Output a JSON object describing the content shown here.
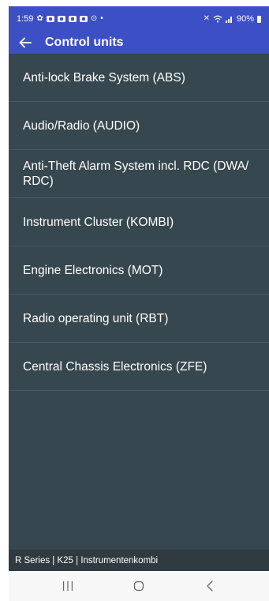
{
  "status_bar": {
    "time": "1:59",
    "battery": "90%",
    "icons": [
      "gear-icon",
      "notification-icon",
      "notification-icon",
      "notification-icon",
      "notification-icon",
      "sync-icon",
      "dot-icon"
    ],
    "right_icons": [
      "mute-icon",
      "wifi-icon",
      "signal-icon",
      "battery-icon"
    ]
  },
  "app_bar": {
    "title": "Control units",
    "back_icon": "arrow-left-icon"
  },
  "control_units": [
    {
      "label": "Anti-lock Brake System (ABS)"
    },
    {
      "label": "Audio/Radio (AUDIO)"
    },
    {
      "label": "Anti-Theft Alarm System incl. RDC (DWA/ RDC)"
    },
    {
      "label": "Instrument Cluster (KOMBI)"
    },
    {
      "label": "Engine Electronics (MOT)"
    },
    {
      "label": "Radio operating unit (RBT)"
    },
    {
      "label": "Central Chassis Electronics (ZFE)"
    }
  ],
  "footer": {
    "text": "R Series | K25 | Instrumentenkombi"
  },
  "nav_bar": {
    "buttons": [
      "recent-apps-icon",
      "home-icon",
      "back-icon"
    ]
  },
  "colors": {
    "app_bar": "#3d4fc4",
    "list_background": "#37474f",
    "divider": "#4a5a62",
    "footer": "#2f3b41",
    "nav_bar": "#f7f7f7",
    "text": "#ffffff"
  }
}
